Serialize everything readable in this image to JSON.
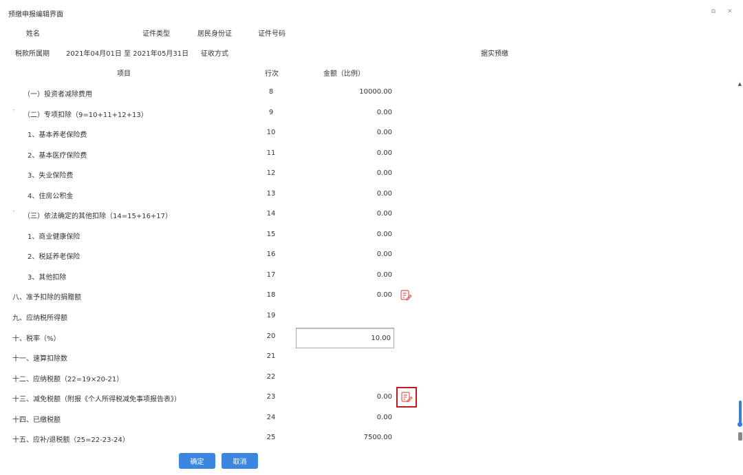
{
  "window": {
    "title": "预缴申报编辑界面",
    "restore_glyph": "⧉",
    "close_glyph": "✕"
  },
  "info": {
    "name_label": "姓名",
    "id_type_label": "证件类型",
    "id_type_value": "居民身份证",
    "id_number_label": "证件号码",
    "period_label": "税款所属期",
    "period_value": "2021年04月01日 至 2021年05月31日",
    "collection_label": "征收方式",
    "collection_value": "据实预缴"
  },
  "columns": {
    "item": "项目",
    "line": "行次",
    "amount": "金额（比例）"
  },
  "rows": [
    {
      "label": "（一）投资者减除费用",
      "line": "8",
      "amount": "10000.00",
      "indent": 1
    },
    {
      "label": "（二）专项扣除（9=10+11+12+13）",
      "line": "9",
      "amount": "0.00",
      "indent": 1,
      "collapse": true
    },
    {
      "label": "1、基本养老保险费",
      "line": "10",
      "amount": "0.00",
      "indent": 2
    },
    {
      "label": "2、基本医疗保险费",
      "line": "11",
      "amount": "0.00",
      "indent": 2
    },
    {
      "label": "3、失业保险费",
      "line": "12",
      "amount": "0.00",
      "indent": 2
    },
    {
      "label": "4、住房公积金",
      "line": "13",
      "amount": "0.00",
      "indent": 2
    },
    {
      "label": "（三）依法确定的其他扣除（14=15+16+17）",
      "line": "14",
      "amount": "0.00",
      "indent": 1,
      "collapse": true
    },
    {
      "label": "1、商业健康保险",
      "line": "15",
      "amount": "0.00",
      "indent": 2
    },
    {
      "label": "2、税延养老保险",
      "line": "16",
      "amount": "0.00",
      "indent": 2
    },
    {
      "label": "3、其他扣除",
      "line": "17",
      "amount": "0.00",
      "indent": 2
    },
    {
      "label": "八、准予扣除的捐赠额",
      "line": "18",
      "amount": "0.00",
      "indent": 0,
      "edit": true
    },
    {
      "label": "九、应纳税所得额",
      "line": "19",
      "amount": "",
      "indent": 0
    },
    {
      "label": "十、税率（%）",
      "line": "20",
      "amount": "10.00",
      "indent": 0,
      "boxed": true
    },
    {
      "label": "十一、速算扣除数",
      "line": "21",
      "amount": "",
      "indent": 0
    },
    {
      "label": "十二、应纳税额（22=19×20-21）",
      "line": "22",
      "amount": "",
      "indent": 0
    },
    {
      "label": "十三、减免税额（附报《个人所得税减免事项报告表》）",
      "line": "23",
      "amount": "0.00",
      "indent": 0,
      "edit": true,
      "highlight": true
    },
    {
      "label": "十四、已缴税额",
      "line": "24",
      "amount": "0.00",
      "indent": 0
    },
    {
      "label": "十五、应补/退税额（25=22-23-24）",
      "line": "25",
      "amount": "7500.00",
      "indent": 0
    }
  ],
  "buttons": {
    "ok": "确定",
    "cancel": "取消"
  },
  "colors": {
    "primary": "#3d86df",
    "highlight": "#c0171d",
    "edit_icon": "#e05a4e"
  }
}
